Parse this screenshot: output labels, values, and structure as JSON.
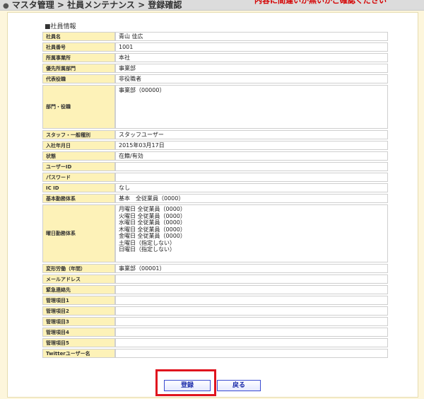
{
  "header": {
    "breadcrumb": "マスタ管理 > 社員メンテナンス > 登録確認",
    "red_note": "内容に間違いが無いかご確認ください"
  },
  "section": {
    "title": "■社員情報"
  },
  "rows": {
    "name": {
      "label": "社員名",
      "value": "青山 佳広"
    },
    "employee_no": {
      "label": "社員番号",
      "value": "1001"
    },
    "office": {
      "label": "所属事業所",
      "value": "本社"
    },
    "priority_dept": {
      "label": "優先所属部門",
      "value": "事業部"
    },
    "title": {
      "label": "代表役職",
      "value": "非役職者"
    },
    "dept_roles": {
      "label": "部門・役職",
      "value": "事業部（00000）"
    },
    "staff_type": {
      "label": "スタッフ・一般種別",
      "value": "スタッフユーザー"
    },
    "join_date": {
      "label": "入社年月日",
      "value": "2015年03月17日"
    },
    "status": {
      "label": "状態",
      "value": "在籍/有効"
    },
    "user_id": {
      "label": "ユーザーID",
      "value": ""
    },
    "password": {
      "label": "パスワード",
      "value": ""
    },
    "ic_id": {
      "label": "IC ID",
      "value": "なし"
    },
    "basic_work": {
      "label": "基本勤務体系",
      "value": "基本　全従業員（0000）"
    },
    "weekday_work": {
      "label": "曜日勤務体系",
      "values": [
        "月曜日 全従業員（0000）",
        "火曜日 全従業員（0000）",
        "水曜日 全従業員（0000）",
        "木曜日 全従業員（0000）",
        "金曜日 全従業員（0000）",
        "土曜日（指定しない）",
        "日曜日（指定しない）"
      ]
    },
    "variable_labor": {
      "label": "変形労働（年間）",
      "value": "事業部（00001）"
    },
    "email": {
      "label": "メールアドレス",
      "value": ""
    },
    "emergency": {
      "label": "緊急連絡先",
      "value": ""
    },
    "mgmt1": {
      "label": "管理項目1",
      "value": ""
    },
    "mgmt2": {
      "label": "管理項目2",
      "value": ""
    },
    "mgmt3": {
      "label": "管理項目3",
      "value": ""
    },
    "mgmt4": {
      "label": "管理項目4",
      "value": ""
    },
    "mgmt5": {
      "label": "管理項目5",
      "value": ""
    },
    "twitter": {
      "label": "Twitterユーザー名",
      "value": ""
    }
  },
  "buttons": {
    "register": "登録",
    "back": "戻る"
  },
  "colors": {
    "highlight": "#e0141e",
    "label_bg": "#fdf2b8",
    "button_text": "#1a2aa8"
  }
}
